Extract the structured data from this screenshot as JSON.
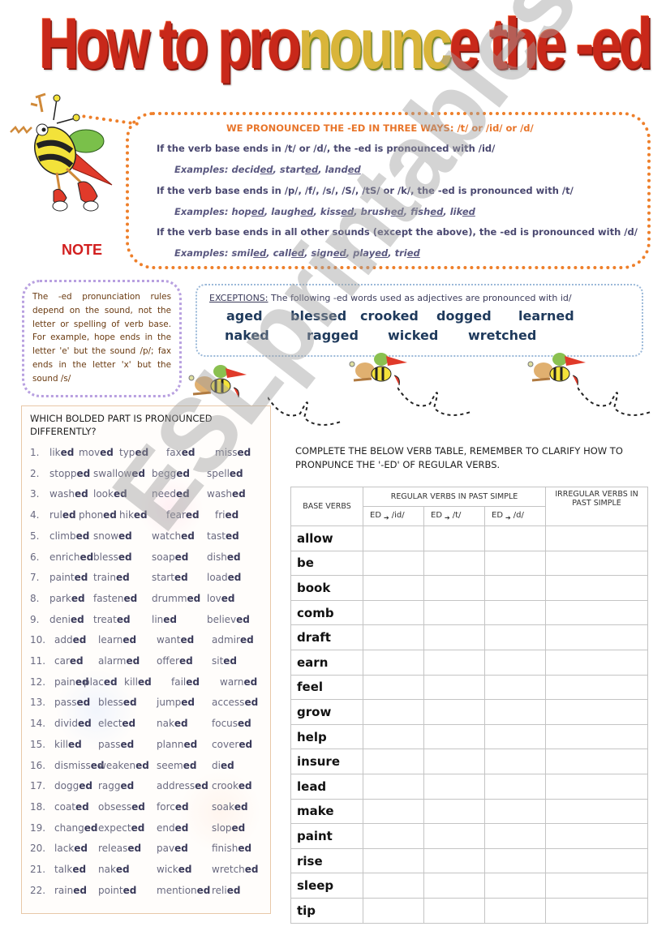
{
  "title": {
    "part1": "How to pro",
    "part2": "nounc",
    "part3": "e the -ed"
  },
  "note_label": "NOTE",
  "rules": {
    "heading": "WE PRONOUNCED THE -ED IN THREE WAYS: /t/ or /id/ or /d/",
    "items": [
      {
        "rule": "If the verb base ends in /t/ or /d/,  the -ed is pronounced with /id/",
        "examples_label": "Examples:",
        "examples": [
          {
            "stem": "decid",
            "ending": "ed"
          },
          {
            "stem": "start",
            "ending": "ed"
          },
          {
            "stem": "land",
            "ending": "ed"
          }
        ]
      },
      {
        "rule": "If the verb base ends in /p/, /f/, /s/, /S/, /tS/ or /k/,  the -ed is pronounced with /t/",
        "examples_label": "Examples:",
        "examples": [
          {
            "stem": "hop",
            "ending": "ed"
          },
          {
            "stem": "laugh",
            "ending": "ed"
          },
          {
            "stem": "kiss",
            "ending": "ed"
          },
          {
            "stem": "brush",
            "ending": "ed"
          },
          {
            "stem": "fish",
            "ending": "ed"
          },
          {
            "stem": "lik",
            "ending": "ed"
          }
        ]
      },
      {
        "rule": "If the verb base ends in all other sounds (except the above),  the -ed is pronounced with /d/",
        "examples_label": "Examples:",
        "examples": [
          {
            "stem": "smil",
            "ending": "ed"
          },
          {
            "stem": "call",
            "ending": "ed"
          },
          {
            "stem": "sign",
            "ending": "ed"
          },
          {
            "stem": "play",
            "ending": "ed"
          },
          {
            "stem": "tri",
            "ending": "ed"
          }
        ]
      }
    ]
  },
  "side_note": "The -ed pronunciation rules depend on the sound, not the letter or spelling of verb base. For example, hope ends in the letter 'e' but the sound /p/; fax ends in the letter 'x' but the sound /s/",
  "exceptions": {
    "label": "EXCEPTIONS:",
    "text": " The following -ed words used as adjectives are pronounced with id/",
    "words": [
      "aged",
      "blessed",
      "crooked",
      "dogged",
      "learned",
      "naked",
      "ragged",
      "wicked",
      "wretched"
    ]
  },
  "quiz": {
    "heading": "WHICH BOLDED PART IS PRONOUNCED DIFFERENTLY?",
    "rows": [
      {
        "num": "1.",
        "words": [
          [
            "lik",
            "ed"
          ],
          [
            "mov",
            "ed"
          ],
          [
            "typ",
            "ed"
          ],
          [
            "fax",
            "ed"
          ],
          [
            "miss",
            "ed"
          ]
        ]
      },
      {
        "num": "2.",
        "words": [
          [
            "stopp",
            "ed"
          ],
          [
            "swallow",
            "ed"
          ],
          [
            "begg",
            "ed"
          ],
          [
            "spell",
            "ed"
          ]
        ]
      },
      {
        "num": "3.",
        "words": [
          [
            "wash",
            "ed"
          ],
          [
            "look",
            "ed"
          ],
          [
            "need",
            "ed"
          ],
          [
            "wash",
            "ed"
          ]
        ]
      },
      {
        "num": "4.",
        "words": [
          [
            "rul",
            "ed"
          ],
          [
            "phon",
            "ed"
          ],
          [
            "hik",
            "ed"
          ],
          [
            "fear",
            "ed"
          ],
          [
            "fri",
            "ed"
          ]
        ]
      },
      {
        "num": "5.",
        "words": [
          [
            "climb",
            "ed"
          ],
          [
            "snow",
            "ed"
          ],
          [
            "watch",
            "ed"
          ],
          [
            "tast",
            "ed"
          ]
        ]
      },
      {
        "num": "6.",
        "words": [
          [
            "enrich",
            "ed"
          ],
          [
            "bless",
            "ed"
          ],
          [
            "soap",
            "ed"
          ],
          [
            "dish",
            "ed"
          ]
        ]
      },
      {
        "num": "7.",
        "words": [
          [
            "paint",
            "ed"
          ],
          [
            "train",
            "ed"
          ],
          [
            "start",
            "ed"
          ],
          [
            "load",
            "ed"
          ]
        ]
      },
      {
        "num": "8.",
        "words": [
          [
            "park",
            "ed"
          ],
          [
            "fasten",
            "ed"
          ],
          [
            "drumm",
            "ed"
          ],
          [
            "lov",
            "ed"
          ]
        ]
      },
      {
        "num": "9.",
        "words": [
          [
            "deni",
            "ed"
          ],
          [
            "treat",
            "ed"
          ],
          [
            "lin",
            "ed"
          ],
          [
            "believ",
            "ed"
          ]
        ]
      },
      {
        "num": "10.",
        "words": [
          [
            "add",
            "ed"
          ],
          [
            "learn",
            "ed"
          ],
          [
            "want",
            "ed"
          ],
          [
            "admir",
            "ed"
          ]
        ]
      },
      {
        "num": "11.",
        "words": [
          [
            "car",
            "ed"
          ],
          [
            "alarm",
            "ed"
          ],
          [
            "offer",
            "ed"
          ],
          [
            "sit",
            "ed"
          ]
        ]
      },
      {
        "num": "12.",
        "words": [
          [
            "pain",
            "ed"
          ],
          [
            "plac",
            "ed"
          ],
          [
            "kill",
            "ed"
          ],
          [
            "fail",
            "ed"
          ],
          [
            "warn",
            "ed"
          ]
        ]
      },
      {
        "num": "13.",
        "words": [
          [
            "pass",
            "ed"
          ],
          [
            "bless",
            "ed"
          ],
          [
            "jump",
            "ed"
          ],
          [
            "access",
            "ed"
          ]
        ]
      },
      {
        "num": "14.",
        "words": [
          [
            "divid",
            "ed"
          ],
          [
            "elect",
            "ed"
          ],
          [
            "nak",
            "ed"
          ],
          [
            "focus",
            "ed"
          ]
        ]
      },
      {
        "num": "15.",
        "words": [
          [
            "kill",
            "ed"
          ],
          [
            "pass",
            "ed"
          ],
          [
            "plann",
            "ed"
          ],
          [
            "cover",
            "ed"
          ]
        ]
      },
      {
        "num": "16.",
        "words": [
          [
            "dismiss",
            "ed"
          ],
          [
            "weaken",
            "ed"
          ],
          [
            "seem",
            "ed"
          ],
          [
            "di",
            "ed"
          ]
        ]
      },
      {
        "num": "17.",
        "words": [
          [
            "dogg",
            "ed"
          ],
          [
            "ragg",
            "ed"
          ],
          [
            "address",
            "ed"
          ],
          [
            "crook",
            "ed"
          ]
        ]
      },
      {
        "num": "18.",
        "words": [
          [
            "coat",
            "ed"
          ],
          [
            "obsess",
            "ed"
          ],
          [
            "forc",
            "ed"
          ],
          [
            "soak",
            "ed"
          ]
        ]
      },
      {
        "num": "19.",
        "words": [
          [
            "chang",
            "ed"
          ],
          [
            "expect",
            "ed"
          ],
          [
            "end",
            "ed"
          ],
          [
            "slop",
            "ed"
          ]
        ]
      },
      {
        "num": "20.",
        "words": [
          [
            "lack",
            "ed"
          ],
          [
            "releas",
            "ed"
          ],
          [
            "pav",
            "ed"
          ],
          [
            "finish",
            "ed"
          ]
        ]
      },
      {
        "num": "21.",
        "words": [
          [
            "talk",
            "ed"
          ],
          [
            "nak",
            "ed"
          ],
          [
            "wick",
            "ed"
          ],
          [
            "wretch",
            "ed"
          ]
        ]
      },
      {
        "num": "22.",
        "words": [
          [
            "rain",
            "ed"
          ],
          [
            "point",
            "ed"
          ],
          [
            "mention",
            "ed"
          ],
          [
            "reli",
            "ed"
          ]
        ]
      }
    ]
  },
  "verb_table": {
    "instructions": "COMPLETE THE BELOW VERB TABLE, REMEMBER TO CLARIFY HOW TO PRONPUNCE THE '-ED' OF REGULAR VERBS.",
    "headers": {
      "base": "BASE VERBS",
      "regular": "REGULAR VERBS IN PAST SIMPLE",
      "irregular": "IRREGULAR VERBS IN PAST SIMPLE",
      "ed_prefix": "ED",
      "arrow": "➔",
      "sub": [
        "/id/",
        "/t/",
        "/d/"
      ]
    },
    "verbs": [
      "allow",
      "be",
      "book",
      "comb",
      "draft",
      "earn",
      "feel",
      "grow",
      "help",
      "insure",
      "lead",
      "make",
      "paint",
      "rise",
      "sleep",
      "tip"
    ]
  },
  "watermark": "ESLprintables.com",
  "colors": {
    "title_red": "#c8281a",
    "rules_border": "#ee7f2a",
    "heading_orange": "#e8752a",
    "rule_text": "#4a4870",
    "note_red": "#d21f1f",
    "side_note_border": "#b8a0e0",
    "exceptions_border": "#9ab8d8",
    "exception_word": "#1f3a5c"
  }
}
